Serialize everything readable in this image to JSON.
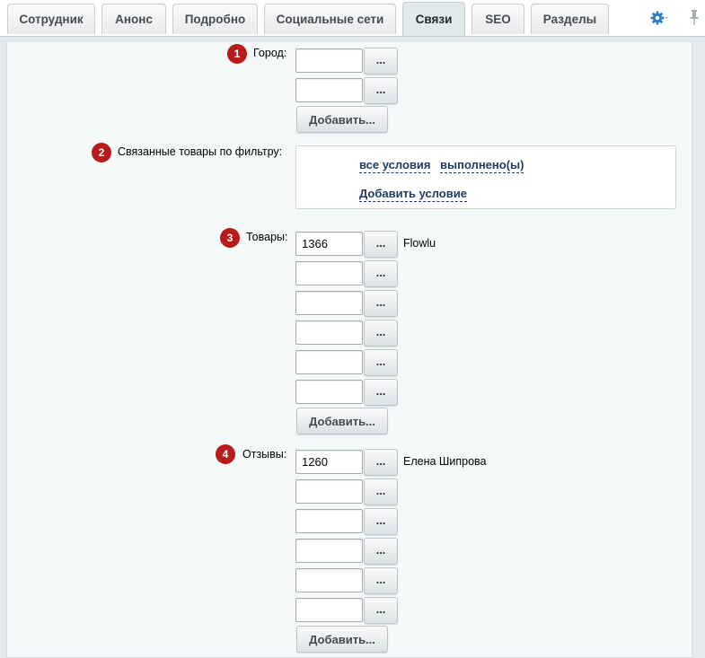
{
  "tabs": [
    {
      "label": "Сотрудник",
      "active": false
    },
    {
      "label": "Анонс",
      "active": false
    },
    {
      "label": "Подробно",
      "active": false
    },
    {
      "label": "Социальные сети",
      "active": false
    },
    {
      "label": "Связи",
      "active": true
    },
    {
      "label": "SEO",
      "active": false
    },
    {
      "label": "Разделы",
      "active": false
    }
  ],
  "toolbar": {
    "settings_icon": "gear-icon",
    "pin_icon": "pin-icon",
    "accent_color": "#2f7fc7"
  },
  "badge_color": "#b81b1b",
  "fields": {
    "city": {
      "badge": "1",
      "label": "Город:",
      "rows": [
        "",
        ""
      ],
      "add_label": "Добавить..."
    },
    "filter": {
      "badge": "2",
      "label": "Связанные товары по фильтру:",
      "condition_all": "все условия",
      "condition_done": "выполнено(ы)",
      "add_condition": "Добавить условие"
    },
    "products": {
      "badge": "3",
      "label": "Товары:",
      "rows": [
        "1366",
        "",
        "",
        "",
        "",
        ""
      ],
      "linked_name": "Flowlu",
      "add_label": "Добавить..."
    },
    "reviews": {
      "badge": "4",
      "label": "Отзывы:",
      "rows": [
        "1260",
        "",
        "",
        "",
        "",
        ""
      ],
      "linked_name": "Елена Шипрова",
      "add_label": "Добавить..."
    }
  },
  "browse_label": "..."
}
